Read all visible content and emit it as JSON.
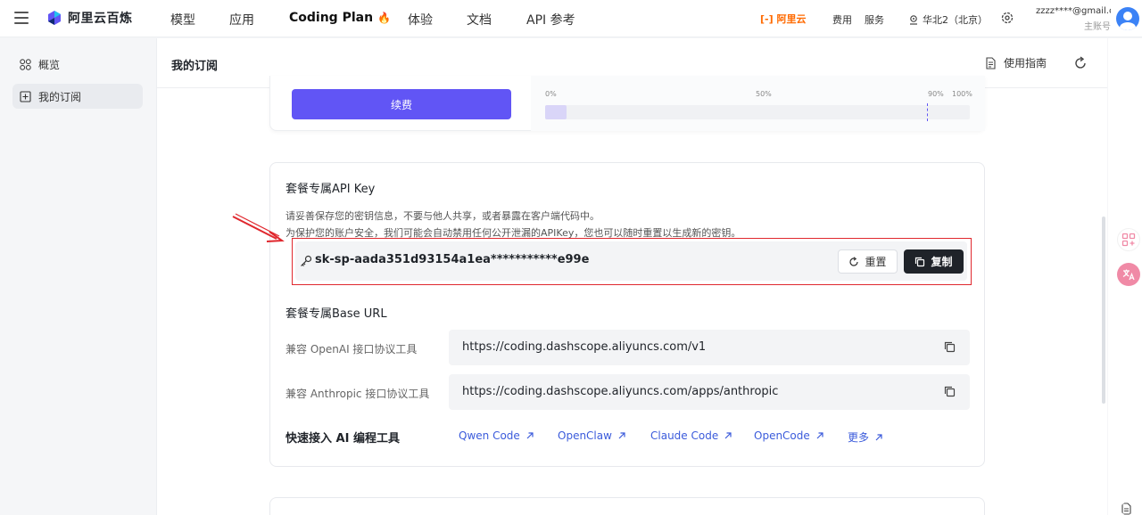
{
  "topbar": {
    "brand": "阿里云百炼",
    "nav": [
      {
        "label": "模型"
      },
      {
        "label": "应用"
      },
      {
        "label": "Coding Plan",
        "icon": "flame-icon"
      },
      {
        "label": "体验"
      },
      {
        "label": "文档"
      },
      {
        "label": "API 参考"
      }
    ],
    "aliyun_logo": "[-] 阿里云",
    "links": {
      "billing": "费用",
      "service": "服务"
    },
    "region": "华北2（北京）",
    "account": {
      "email": "zzzz****@gmail.c...",
      "role": "主账号"
    }
  },
  "sidebar": {
    "items": [
      {
        "label": "概览",
        "icon": "overview-icon"
      },
      {
        "label": "我的订阅",
        "icon": "subscription-icon",
        "active": true
      }
    ]
  },
  "header": {
    "title": "我的订阅",
    "guide": "使用指南"
  },
  "plan": {
    "renew_label": "续费",
    "usage_ticks": [
      "0%",
      "50%",
      "90%",
      "100%"
    ],
    "usage_fraction": 0.05,
    "warn_fraction": 0.9
  },
  "api_key": {
    "title": "套餐专属API Key",
    "note1": "请妥善保存您的密钥信息，不要与他人共享，或者暴露在客户端代码中。",
    "note2": "为保护您的账户安全，我们可能会自动禁用任何公开泄漏的APIKey，您也可以随时重置以生成新的密钥。",
    "value": "sk-sp-aada351d93154a1ea***********e99e",
    "reset_label": "重置",
    "copy_label": "复制"
  },
  "base_url": {
    "title": "套餐专属Base URL",
    "rows": [
      {
        "label": "兼容 OpenAI 接口协议工具",
        "url": "https://coding.dashscope.aliyuncs.com/v1"
      },
      {
        "label": "兼容 Anthropic 接口协议工具",
        "url": "https://coding.dashscope.aliyuncs.com/apps/anthropic"
      }
    ]
  },
  "tools": {
    "title": "快速接入 AI 编程工具",
    "links": [
      "Qwen Code",
      "OpenClaw",
      "Claude Code",
      "OpenCode",
      "更多"
    ]
  },
  "colors": {
    "accent": "#6155f5",
    "highlight_border": "#e0282e",
    "link": "#3b5bdb",
    "brand_orange": "#ff6a00"
  }
}
